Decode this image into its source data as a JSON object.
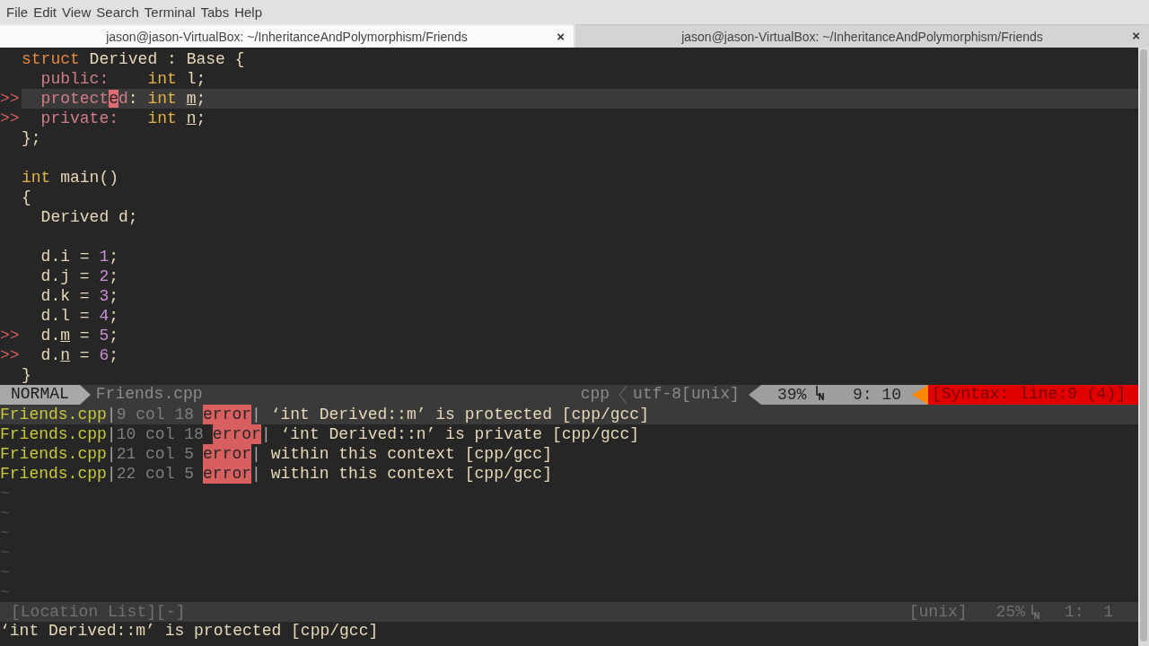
{
  "menu": [
    "File",
    "Edit",
    "View",
    "Search",
    "Terminal",
    "Tabs",
    "Help"
  ],
  "tabs": [
    {
      "title": "jason@jason-VirtualBox: ~/InheritanceAndPolymorphism/Friends",
      "close": "×",
      "selected": true
    },
    {
      "title": "jason@jason-VirtualBox: ~/InheritanceAndPolymorphism/Friends",
      "close": "×",
      "selected": false
    }
  ],
  "editor": {
    "lines": [
      {
        "current": false,
        "tokens": [
          {
            "text": "struct",
            "kind": "keyword"
          },
          {
            "text": " Derived : Base {",
            "kind": "plain"
          }
        ]
      },
      {
        "current": false,
        "tokens": [
          {
            "text": "  public:",
            "kind": "access"
          },
          {
            "text": "    int",
            "kind": "type"
          },
          {
            "text": " l;",
            "kind": "plain"
          }
        ]
      },
      {
        "sign": ">>",
        "current": true,
        "tokens": [
          {
            "text": "  protect",
            "kind": "access"
          },
          {
            "text": "e",
            "kind": "cursor"
          },
          {
            "text": "d",
            "kind": "access"
          },
          {
            "text": ": ",
            "kind": "plain"
          },
          {
            "text": "int ",
            "kind": "type"
          },
          {
            "text": "m",
            "kind": "flagged"
          },
          {
            "text": ";",
            "kind": "plain"
          }
        ]
      },
      {
        "sign": ">>",
        "current": false,
        "tokens": [
          {
            "text": "  private:",
            "kind": "access"
          },
          {
            "text": "   int ",
            "kind": "type"
          },
          {
            "text": "n",
            "kind": "flagged"
          },
          {
            "text": ";",
            "kind": "plain"
          }
        ]
      },
      {
        "current": false,
        "tokens": [
          {
            "text": "};",
            "kind": "plain"
          }
        ]
      },
      {
        "current": false
      },
      {
        "current": false,
        "tokens": [
          {
            "text": "int",
            "kind": "type"
          },
          {
            "text": " main()",
            "kind": "plain"
          }
        ]
      },
      {
        "current": false,
        "tokens": [
          {
            "text": "{",
            "kind": "plain"
          }
        ]
      },
      {
        "current": false,
        "tokens": [
          {
            "text": "  Derived d;",
            "kind": "plain"
          }
        ]
      },
      {
        "current": false
      },
      {
        "current": false,
        "tokens": [
          {
            "text": "  d.i = ",
            "kind": "plain"
          },
          {
            "text": "1",
            "kind": "number"
          },
          {
            "text": ";",
            "kind": "plain"
          }
        ]
      },
      {
        "current": false,
        "tokens": [
          {
            "text": "  d.j = ",
            "kind": "plain"
          },
          {
            "text": "2",
            "kind": "number"
          },
          {
            "text": ";",
            "kind": "plain"
          }
        ]
      },
      {
        "current": false,
        "tokens": [
          {
            "text": "  d.k = ",
            "kind": "plain"
          },
          {
            "text": "3",
            "kind": "number"
          },
          {
            "text": ";",
            "kind": "plain"
          }
        ]
      },
      {
        "current": false,
        "tokens": [
          {
            "text": "  d.l = ",
            "kind": "plain"
          },
          {
            "text": "4",
            "kind": "number"
          },
          {
            "text": ";",
            "kind": "plain"
          }
        ]
      },
      {
        "sign": ">>",
        "current": false,
        "tokens": [
          {
            "text": "  d.",
            "kind": "plain"
          },
          {
            "text": "m",
            "kind": "flagged"
          },
          {
            "text": " = ",
            "kind": "plain"
          },
          {
            "text": "5",
            "kind": "number"
          },
          {
            "text": ";",
            "kind": "plain"
          }
        ]
      },
      {
        "sign": ">>",
        "current": false,
        "tokens": [
          {
            "text": "  d.",
            "kind": "plain"
          },
          {
            "text": "n",
            "kind": "flagged"
          },
          {
            "text": " = ",
            "kind": "plain"
          },
          {
            "text": "6",
            "kind": "number"
          },
          {
            "text": ";",
            "kind": "plain"
          }
        ]
      },
      {
        "current": false,
        "tokens": [
          {
            "text": "}",
            "kind": "plain"
          }
        ]
      }
    ]
  },
  "status": {
    "mode": "NORMAL",
    "file": "Friends.cpp",
    "filetype": "cpp",
    "encoding": "utf-8[unix]",
    "percent": "39%",
    "position": "9: 10",
    "syntax": "[Syntax: line:9 (4)]"
  },
  "quickfix": {
    "rows": [
      {
        "file": "Friends.cpp",
        "divider_1": "|",
        "location": "9 col 18",
        "type": "error",
        "divider_2": "|",
        "message": " ‘int Derived::m’ is protected [cpp/gcc]",
        "selected": true
      },
      {
        "file": "Friends.cpp",
        "divider_1": "|",
        "location": "10 col 18",
        "type": "error",
        "divider_2": "|",
        "message": " ‘int Derived::n’ is private [cpp/gcc]",
        "selected": false
      },
      {
        "file": "Friends.cpp",
        "divider_1": "|",
        "location": "21 col 5",
        "type": "error",
        "divider_2": "|",
        "message": " within this context [cpp/gcc]",
        "selected": false
      },
      {
        "file": "Friends.cpp",
        "divider_1": "|",
        "location": "22 col 5",
        "type": "error",
        "divider_2": "|",
        "message": " within this context [cpp/gcc]",
        "selected": false
      }
    ],
    "filler": [
      "~",
      "~",
      "~",
      "~",
      "~",
      "~"
    ]
  },
  "location_status": {
    "title": "[Location List][-]",
    "format": "[unix]",
    "percent": "25%",
    "position": "1:  1"
  },
  "command_line": {
    "message": "‘int Derived::m’ is protected [cpp/gcc]"
  }
}
